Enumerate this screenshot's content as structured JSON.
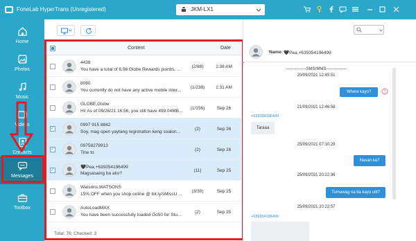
{
  "app": {
    "title": "FoneLab HyperTrans (Unregistered)",
    "device_name": "JKM-LX1"
  },
  "sidebar": {
    "items": [
      {
        "label": "Home",
        "icon": "home-icon"
      },
      {
        "label": "Photos",
        "icon": "photos-icon"
      },
      {
        "label": "Music",
        "icon": "music-icon"
      },
      {
        "label": "Videos",
        "icon": "videos-icon"
      },
      {
        "label": "Contacts",
        "icon": "contacts-icon"
      },
      {
        "label": "Messages",
        "icon": "messages-icon",
        "active": true
      },
      {
        "label": "Toolbox",
        "icon": "toolbox-icon"
      }
    ]
  },
  "list": {
    "header_content": "Content",
    "header_date": "Date",
    "rows": [
      {
        "name": "4438",
        "preview": "You have a total of 8.98 Globe Rewards point/s. ...",
        "count": "(2/88)",
        "date": "1:38 AM",
        "checked": false
      },
      {
        "name": "8080",
        "preview": "You currently do not have any active mobile inter...",
        "count": "(1/238)",
        "date": "1:31 AM",
        "checked": false
      },
      {
        "name": "GLOBE,Globe",
        "preview": "Hi! As of 09/26/21 16:56, you still have 499.04MB...",
        "count": "(1/156)",
        "date": "Sep 26",
        "checked": false
      },
      {
        "name": "0997 915 8842",
        "preview": "Soy, mag open yaytang registration keng soalon...",
        "count": "(2)",
        "date": "Sep 26",
        "checked": true
      },
      {
        "name": "09758279913",
        "preview": "Tine to",
        "count": "(2)",
        "date": "Sep 26",
        "checked": true
      },
      {
        "name": "🖤Pea,+639354196499",
        "preview": "Magsasaing ba ako?",
        "count": "(11)",
        "date": "Sep 25",
        "checked": true
      },
      {
        "name": "Watsons,WATSONS",
        "preview": "15% OFF when you shop online @ bit.ly/sMissU ...",
        "count": "(3/30)",
        "date": "Sep 25",
        "checked": false
      },
      {
        "name": "AutoLoadMAX",
        "preview": "You have been successfully loaded Go50 for Stu...",
        "count": "(2)",
        "date": "Sep 25",
        "checked": false
      }
    ],
    "footer": "Total: 76; Checked: 3"
  },
  "conversation": {
    "name_label": "Name:",
    "name": "🖤Pea,+639354196499",
    "type_divider": "SMS/MMS",
    "sender_number": "+639354196499",
    "messages": [
      {
        "timestamp": "20/09/2021 12:45:51",
        "text": "Where kayo?",
        "direction": "out"
      },
      {
        "timestamp": "21/09/2021 12:46:58",
        "text": "Taraaa",
        "direction": "in"
      },
      {
        "timestamp": "25/09/2021 07:10:29",
        "text": "Nasan ka?",
        "direction": "out"
      },
      {
        "timestamp": "25/09/2021 20:22:36",
        "text": "Tumawag na ba kayo ulit?",
        "direction": "out"
      },
      {
        "timestamp": "25/09/2021 20:22:57",
        "text": "",
        "direction": "in"
      }
    ]
  },
  "colors": {
    "brand": "#2aa7c9",
    "active_nav": "#1d7e9b",
    "highlight_red": "#e31b23",
    "bubble_out": "#2f8fd8",
    "row_selected": "#d8ecfa"
  }
}
